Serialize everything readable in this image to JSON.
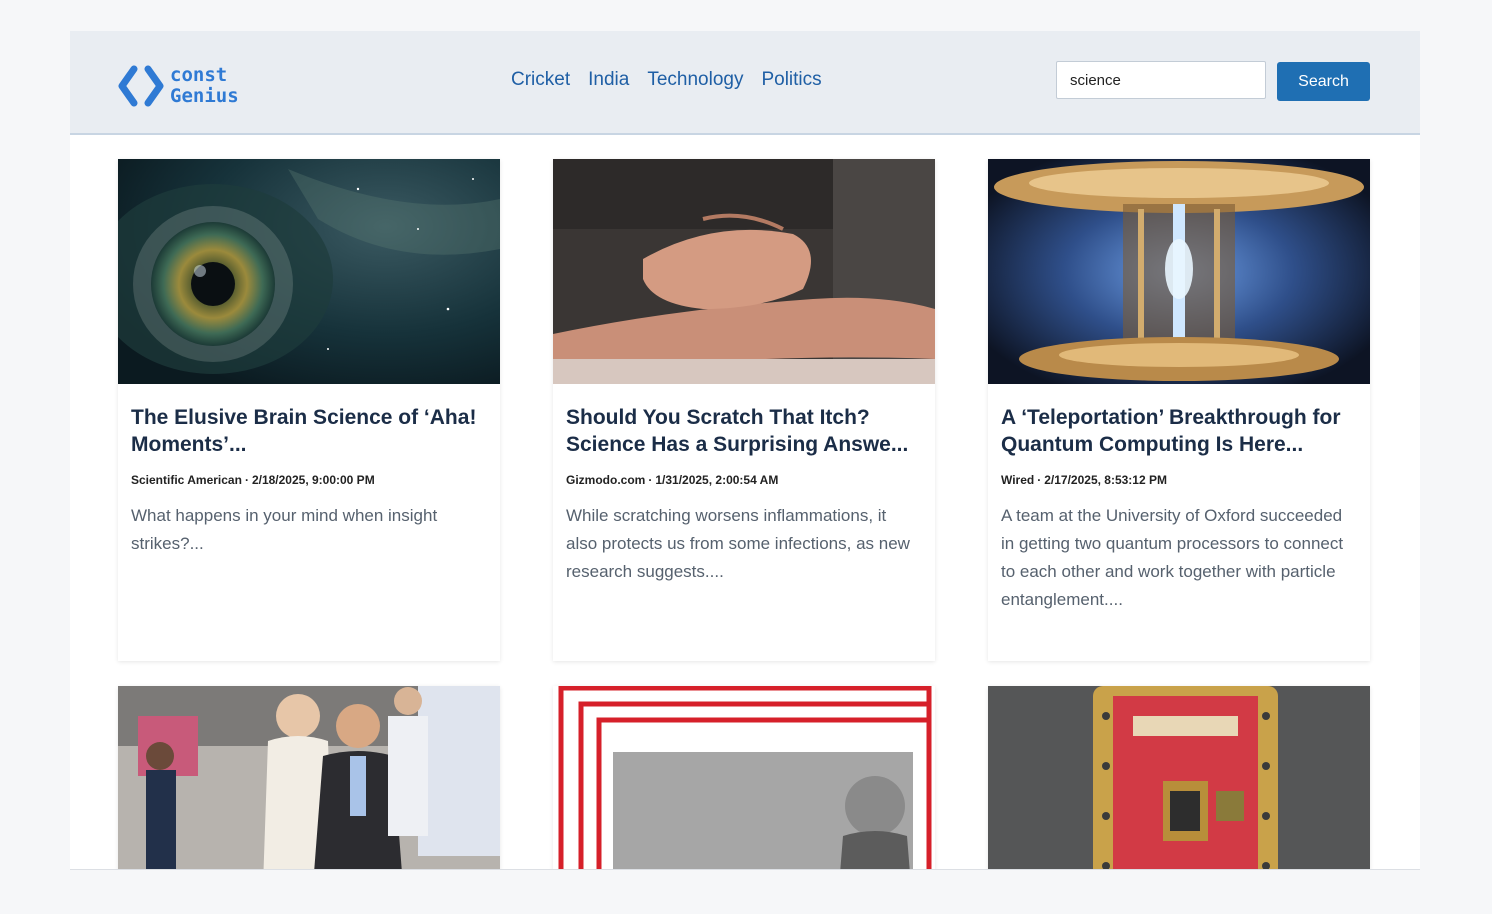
{
  "brand": {
    "line1": "const",
    "line2": "Genius",
    "icon": "code-brackets-icon",
    "color": "#2f7ad4"
  },
  "nav": {
    "items": [
      "Cricket",
      "India",
      "Technology",
      "Politics"
    ]
  },
  "search": {
    "value": "science",
    "button_label": "Search",
    "button_color": "#1f6fb3"
  },
  "articles": [
    {
      "title": "The Elusive Brain Science of ‘Aha! Moments’...",
      "source": "Scientific American",
      "date": "2/18/2025, 9:00:00 PM",
      "description": "What happens in your mind when insight strikes?...",
      "image": "eye-galaxy-image"
    },
    {
      "title": "Should You Scratch That Itch? Science Has a Surprising Answe...",
      "source": "Gizmodo.com",
      "date": "1/31/2025, 2:00:54 AM",
      "description": "While scratching worsens inflammations, it also protects us from some infections, as new research suggests....",
      "image": "arm-scratching-image"
    },
    {
      "title": "A ‘Teleportation’ Breakthrough for Quantum Computing Is Here...",
      "source": "Wired",
      "date": "2/17/2025, 8:53:12 PM",
      "description": "A team at the University of Oxford succeeded in getting two quantum processors to connect to each other and work together with particle entanglement....",
      "image": "quantum-computer-image"
    },
    {
      "image": "people-at-event-image"
    },
    {
      "image": "red-frame-portrait-image"
    },
    {
      "image": "microsoft-quantum-chip-image"
    }
  ]
}
